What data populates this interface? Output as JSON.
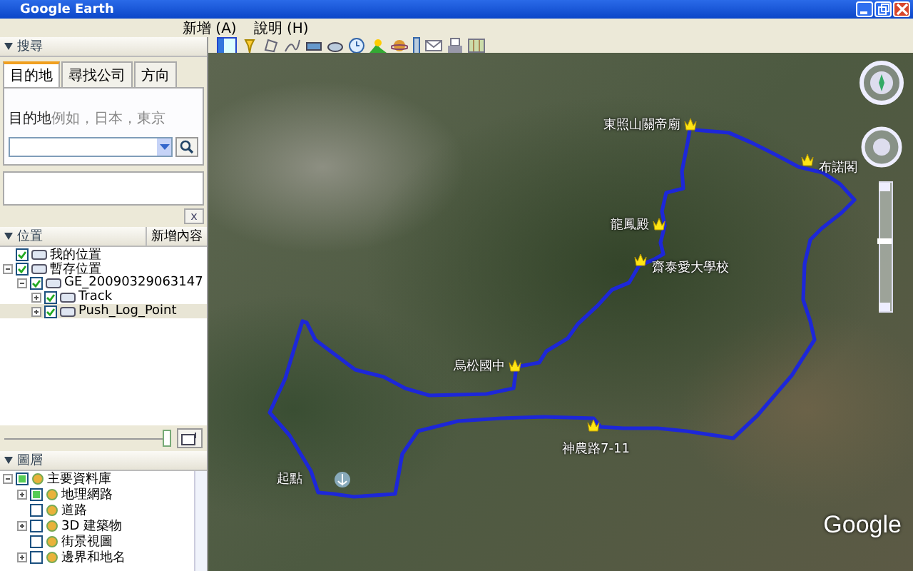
{
  "window": {
    "title": "Google Earth"
  },
  "menu": [
    {
      "label": "新增 (A)"
    },
    {
      "label": "說明 (H)"
    }
  ],
  "search": {
    "header": "搜尋",
    "tabs": [
      {
        "label": "目的地",
        "selected": true
      },
      {
        "label": "尋找公司",
        "selected": false
      },
      {
        "label": "方向",
        "selected": false
      }
    ],
    "field_label": "目的地",
    "placeholder": "例如，日本，東京",
    "clear": "x"
  },
  "places": {
    "header": "位置",
    "add_button": "新增內容",
    "items": [
      {
        "label": "我的位置",
        "expandable": false,
        "checked": true,
        "selected": false
      },
      {
        "label": "暫存位置",
        "expandable": true,
        "expanded": true,
        "checked": true,
        "selected": false,
        "children": [
          {
            "label": "GE_20090329063147",
            "expandable": true,
            "expanded": true,
            "checked": true,
            "selected": false,
            "children": [
              {
                "label": "Track",
                "expandable": true,
                "expanded": false,
                "checked": true,
                "selected": false
              },
              {
                "label": "Push_Log_Point",
                "expandable": true,
                "expanded": false,
                "checked": true,
                "selected": true
              }
            ]
          }
        ]
      }
    ],
    "slider": {
      "level": 1
    }
  },
  "layers": {
    "header": "圖層",
    "items": [
      {
        "label": "主要資料庫",
        "expandable": true,
        "expanded": true,
        "checked": true,
        "partial": true,
        "selected": false,
        "children": [
          {
            "label": "地理網路",
            "expandable": true,
            "expanded": false,
            "checked": true,
            "partial": true,
            "selected": false
          },
          {
            "label": "道路",
            "expandable": false,
            "checked": false,
            "selected": false
          },
          {
            "label": "3D 建築物",
            "expandable": true,
            "expanded": false,
            "checked": false,
            "selected": false
          },
          {
            "label": "街景視圖",
            "expandable": false,
            "checked": false,
            "selected": false
          },
          {
            "label": "邊界和地名",
            "expandable": true,
            "expanded": false,
            "checked": false,
            "selected": false
          }
        ]
      }
    ]
  },
  "map": {
    "labels": [
      {
        "text": "東照山關帝廟",
        "kind": "placemark"
      },
      {
        "text": "布諾閣",
        "kind": "placemark"
      },
      {
        "text": "龍鳳殿",
        "kind": "placemark"
      },
      {
        "text": "齋泰愛大學校",
        "kind": "placemark"
      },
      {
        "text": "烏松國中",
        "kind": "placemark"
      },
      {
        "text": "神農路7-11",
        "kind": "placemark"
      },
      {
        "text": "起點",
        "kind": "start"
      }
    ],
    "zoom": {
      "level": 0.55
    },
    "logo": "Google"
  }
}
